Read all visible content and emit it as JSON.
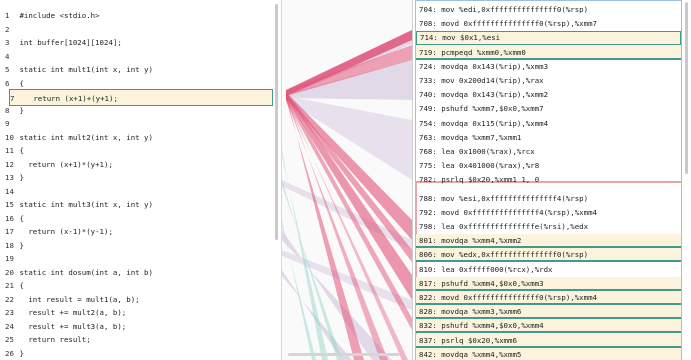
{
  "colors": {
    "highlight_fill": "#fbf3dc",
    "highlight_border": "#3f9c8c",
    "map_primary": "#e2537a",
    "map_lavender": "#b79dc9",
    "map_teal": "#8ed3c6",
    "asm_group_border": "#e7a7a7"
  },
  "source": {
    "highlighted_line": 7,
    "lines": [
      {
        "n": "1",
        "code": "#include <stdio.h>"
      },
      {
        "n": "2",
        "code": ""
      },
      {
        "n": "3",
        "code": "int buffer[1024][1024];"
      },
      {
        "n": "4",
        "code": ""
      },
      {
        "n": "5",
        "code": "static int mult1(int x, int y)"
      },
      {
        "n": "6",
        "code": "{"
      },
      {
        "n": "7",
        "code": "  return (x+1)+(y+1);"
      },
      {
        "n": "8",
        "code": "}"
      },
      {
        "n": "9",
        "code": ""
      },
      {
        "n": "10",
        "code": "static int mult2(int x, int y)"
      },
      {
        "n": "11",
        "code": "{"
      },
      {
        "n": "12",
        "code": "  return (x+1)*(y+1);"
      },
      {
        "n": "13",
        "code": "}"
      },
      {
        "n": "14",
        "code": ""
      },
      {
        "n": "15",
        "code": "static int mult3(int x, int y)"
      },
      {
        "n": "16",
        "code": "{"
      },
      {
        "n": "17",
        "code": "  return (x-1)*(y-1);"
      },
      {
        "n": "18",
        "code": "}"
      },
      {
        "n": "19",
        "code": ""
      },
      {
        "n": "20",
        "code": "static int dosum(int a, int b)"
      },
      {
        "n": "21",
        "code": "{"
      },
      {
        "n": "22",
        "code": "  int result = mult1(a, b);"
      },
      {
        "n": "23",
        "code": "  result += mult2(a, b);"
      },
      {
        "n": "24",
        "code": "  result += mult3(a, b);"
      },
      {
        "n": "25",
        "code": "  return result;"
      },
      {
        "n": "26",
        "code": "}"
      },
      {
        "n": "27",
        "code": ""
      }
    ]
  },
  "assembly": {
    "rows": [
      {
        "text": "704: mov %edi,0xfffffffffffffff0(%rsp)",
        "hl": false
      },
      {
        "text": "708: movd 0xfffffffffffffff0(%rsp),%xmm7",
        "hl": false
      },
      {
        "text": "714: mov $0x1,%esi",
        "hl": true
      },
      {
        "text": "719: pcmpeqd %xmm0,%xmm0",
        "hl": true
      },
      {
        "text": "724: movdqa 0x143(%rip),%xmm3",
        "hl": false
      },
      {
        "text": "733: mov 0x200d14(%rip),%rax",
        "hl": false
      },
      {
        "text": "740: movdqa 0x143(%rip),%xmm2",
        "hl": false
      },
      {
        "text": "749: pshufd %xmm7,$0x0,%xmm7",
        "hl": false
      },
      {
        "text": "754: movdqa 0x115(%rip),%xmm4",
        "hl": false
      },
      {
        "text": "763: movdqa %xmm7,%xmm1",
        "hl": false
      },
      {
        "text": "768: lea 0x1000(%rax),%rcx",
        "hl": false
      },
      {
        "text": "775: lea 0x401000(%rax),%r8",
        "hl": false
      },
      {
        "text": "782: psrlq $0x20,%xmm1 1, 0",
        "hl": false
      },
      {
        "text": "788: mov %esi,0xfffffffffffffff4(%rsp)",
        "hl": false
      },
      {
        "text": "792: movd 0xfffffffffffffff4(%rsp),%xmm4",
        "hl": false
      },
      {
        "text": "798: lea 0xfffffffffffffffe(%rsi),%edx",
        "hl": false
      },
      {
        "text": "801: movdqa %xmm4,%xmm2",
        "hl": true
      },
      {
        "text": "806: mov %edx,0xfffffffffffffff0(%rsp)",
        "hl": true
      },
      {
        "text": "810: lea 0xfffff000(%rcx),%rdx",
        "hl": false
      },
      {
        "text": "817: pshufd %xmm4,$0x0,%xmm3",
        "hl": true
      },
      {
        "text": "822: movd 0xfffffffffffffff0(%rsp),%xmm4",
        "hl": true
      },
      {
        "text": "828: movdqa %xmm3,%xmm6",
        "hl": true
      },
      {
        "text": "832: pshufd %xmm4,$0x0,%xmm4",
        "hl": true
      },
      {
        "text": "837: psrlq $0x20,%xmm6",
        "hl": true
      },
      {
        "text": "842: movdqa %xmm4,%xmm5",
        "hl": true
      }
    ]
  }
}
